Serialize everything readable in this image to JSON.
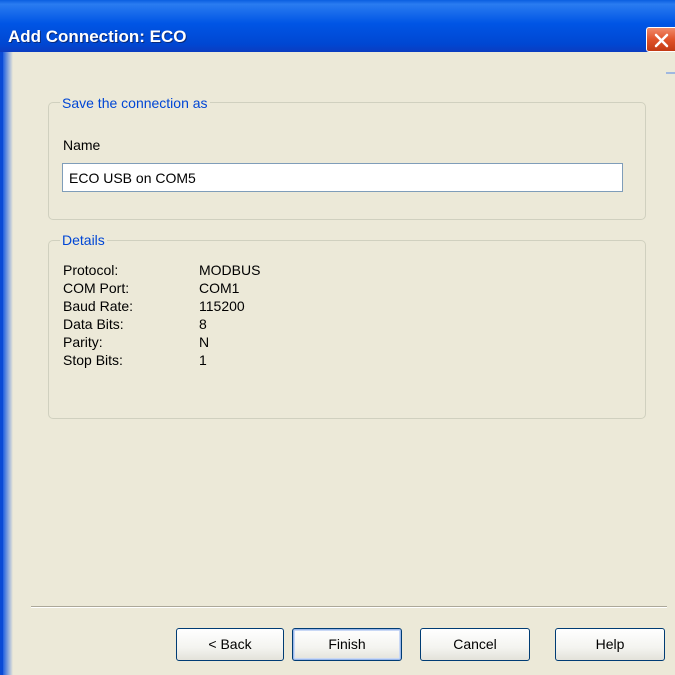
{
  "window": {
    "title": "Add Connection: ECO"
  },
  "save_group": {
    "legend": "Save the connection as",
    "name_label": "Name",
    "name_value": "ECO USB on COM5"
  },
  "details_group": {
    "legend": "Details",
    "rows": [
      {
        "key": "Protocol:",
        "value": "MODBUS"
      },
      {
        "key": "COM Port:",
        "value": "COM1"
      },
      {
        "key": "Baud Rate:",
        "value": "115200"
      },
      {
        "key": "Data Bits:",
        "value": "8"
      },
      {
        "key": "Parity:",
        "value": "N"
      },
      {
        "key": "Stop Bits:",
        "value": "1"
      }
    ]
  },
  "buttons": {
    "back": "< Back",
    "finish": "Finish",
    "cancel": "Cancel",
    "help": "Help"
  },
  "colors": {
    "titlebar": "#0055e5",
    "legend": "#0046d5",
    "close": "#e0532a"
  },
  "icons": {
    "close": "close-icon"
  }
}
